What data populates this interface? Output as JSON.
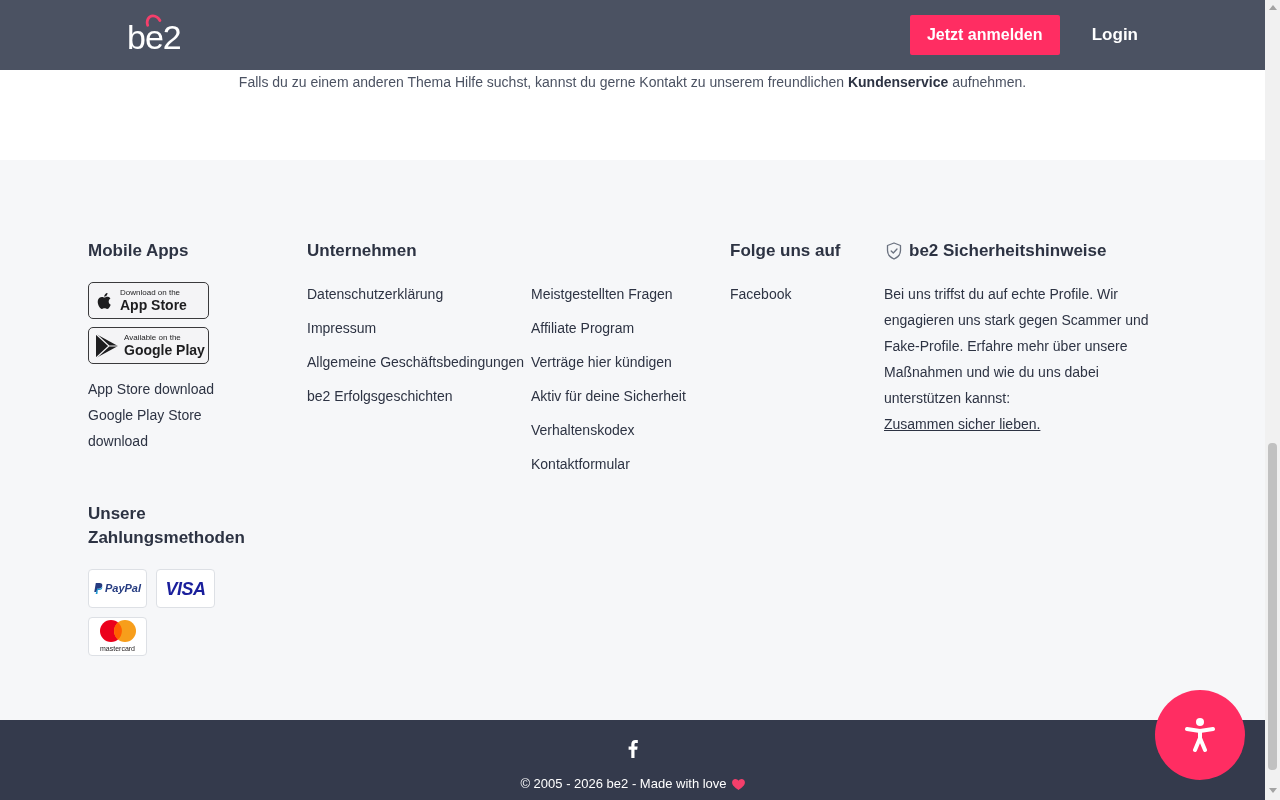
{
  "header": {
    "logo": "be2",
    "buttons": [
      {
        "kind": "primary",
        "label": "Jetzt anmelden"
      },
      {
        "kind": "link",
        "label": "Login"
      }
    ]
  },
  "notice": {
    "text": "Falls du zu einem anderen Thema Hilfe suchst, kannst du gerne Kontakt zu unserem freundlichen",
    "link": "Kundenservice",
    "text_after": "aufnehmen."
  },
  "footer": {
    "mobile_apps": {
      "title": "Mobile Apps",
      "badges": [
        {
          "kind": "apple",
          "caption": "Download on the",
          "store": "App Store"
        },
        {
          "kind": "google",
          "caption": "Available on the",
          "store": "Google Play"
        }
      ],
      "links": [
        "App Store download",
        "Google Play Store download"
      ]
    },
    "payments": {
      "title": "Unsere Zahlungsmethoden",
      "methods": [
        {
          "kind": "paypal",
          "label": "PayPal"
        },
        {
          "kind": "visa",
          "label": "VISA"
        },
        {
          "kind": "mastercard",
          "label": "mastercard"
        }
      ]
    },
    "company": {
      "title": "Unternehmen",
      "columns": [
        [
          "Datenschutzerklärung",
          "Impressum",
          "Allgemeine Geschäftsbedingungen",
          "be2 Erfolgsgeschichten"
        ],
        [
          "Meistgestellten Fragen",
          "Affiliate Program",
          "Verträge hier kündigen",
          "Aktiv für deine Sicherheit",
          "Verhaltenskodex",
          "Kontaktformular"
        ]
      ]
    },
    "social": {
      "title": "Folge uns auf",
      "links": [
        "Facebook"
      ]
    },
    "safety": {
      "title": "be2 Sicherheitshinweise",
      "text": "Bei uns triffst du auf echte Profile. Wir engagieren uns stark gegen Scammer und Fake-Profile. Erfahre mehr über unsere Maßnahmen und wie du uns dabei unterstützen kannst:",
      "link": "Zusammen sicher lieben."
    }
  },
  "bottom_bar": {
    "copyright": "© 2005 - 2026 be2 - Made with love"
  }
}
